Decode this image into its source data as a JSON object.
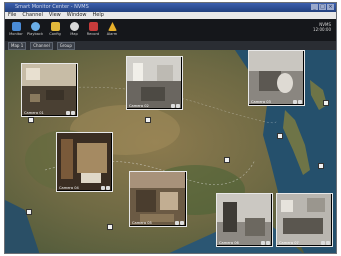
{
  "app": {
    "title": "Smart Monitor Center - NVMS"
  },
  "menu": [
    "File",
    "Channel",
    "View",
    "Window",
    "Help"
  ],
  "toolbar": [
    {
      "label": "Monitor",
      "color": "#4a8bd6",
      "icon": "monitor-icon"
    },
    {
      "label": "Playback",
      "color": "#6aaee8",
      "icon": "playback-icon"
    },
    {
      "label": "Config",
      "color": "#e2b93b",
      "icon": "folder-icon"
    },
    {
      "label": "Map",
      "color": "#d9d9d9",
      "icon": "map-icon"
    },
    {
      "label": "Record",
      "color": "#c63b3b",
      "icon": "record-icon"
    },
    {
      "label": "Alarm",
      "color": "#e8b02a",
      "icon": "alarm-icon"
    }
  ],
  "brand": {
    "line1": "NVMS",
    "line2": "12:00:00"
  },
  "tabs": [
    "Map 1",
    "Channel",
    "Group"
  ],
  "cameras": [
    {
      "label": "Camera 01"
    },
    {
      "label": "Camera 02"
    },
    {
      "label": "Camera 03"
    },
    {
      "label": "Camera 04"
    },
    {
      "label": "Camera 05"
    },
    {
      "label": "Camera 06"
    },
    {
      "label": "Camera 07"
    }
  ]
}
